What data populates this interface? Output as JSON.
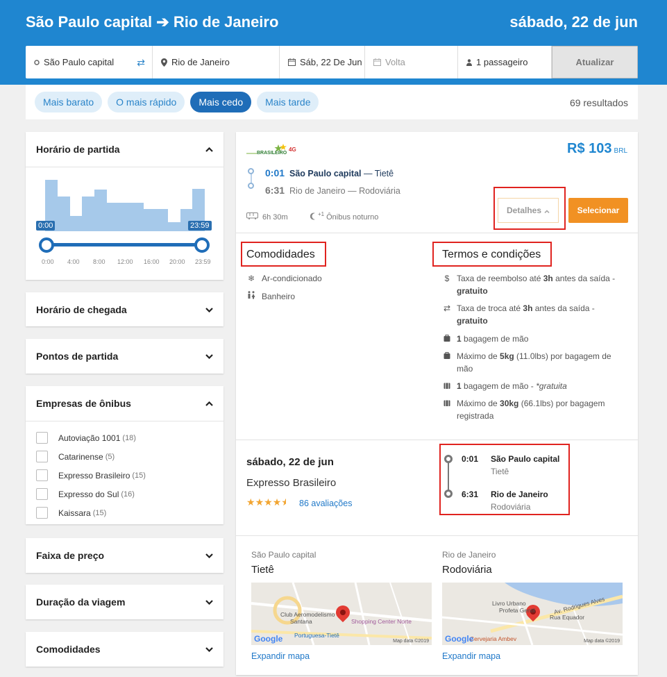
{
  "header": {
    "title": "São Paulo capital ➔ Rio de Janeiro",
    "date": "sábado, 22 de jun",
    "origin": "São Paulo capital",
    "destination": "Rio de Janeiro",
    "depart_date": "Sáb, 22 De Jun",
    "return_placeholder": "Volta",
    "passengers": "1 passageiro",
    "update_label": "Atualizar"
  },
  "sort": {
    "chips": [
      "Mais barato",
      "O mais rápido",
      "Mais cedo",
      "Mais tarde"
    ],
    "active_index": 2,
    "results": "69 resultados"
  },
  "filters": {
    "departure_time": {
      "title": "Horário de partida",
      "start_label": "0:00",
      "end_label": "23:59",
      "ticks": [
        "0:00",
        "4:00",
        "8:00",
        "12:00",
        "16:00",
        "20:00",
        "23:59"
      ],
      "histogram": [
        1.0,
        0.68,
        0.3,
        0.68,
        0.81,
        0.55,
        0.55,
        0.55,
        0.43,
        0.43,
        0.17,
        0.43,
        0.82
      ]
    },
    "arrival_time": "Horário de chegada",
    "departure_points": "Pontos de partida",
    "companies": {
      "title": "Empresas de ônibus",
      "items": [
        {
          "name": "Autoviação 1001",
          "count": "(18)"
        },
        {
          "name": "Catarinense",
          "count": "(5)"
        },
        {
          "name": "Expresso Brasileiro",
          "count": "(15)"
        },
        {
          "name": "Expresso do Sul",
          "count": "(16)"
        },
        {
          "name": "Kaissara",
          "count": "(15)"
        }
      ]
    },
    "price_range": "Faixa de preço",
    "trip_duration": "Duração da viagem",
    "amenities": "Comodidades"
  },
  "trip": {
    "logo_text": "BRASILEIRO",
    "logo_badge": "4G",
    "price": "R$ 103",
    "currency": "BRL",
    "depart_time": "0:01",
    "depart_place": "São Paulo capital",
    "depart_station": "— Tietê",
    "arrive_time": "6:31",
    "arrive_place": "Rio de Janeiro",
    "arrive_station": "— Rodoviária",
    "duration": "6h 30m",
    "night_label": "Ônibus noturno",
    "night_badge": "+1",
    "details_label": "Detalhes",
    "select_label": "Selecionar",
    "amenities_title": "Comodidades",
    "amenities": [
      "Ar-condicionado",
      "Banheiro"
    ],
    "terms_title": "Termos e condições",
    "terms": {
      "refund_pre": "Taxa de reembolso até ",
      "refund_hours": "3h",
      "refund_post": " antes da saída -",
      "refund_free": "gratuito",
      "exchange_pre": "Taxa de troca até ",
      "exchange_hours": "3h",
      "exchange_post": " antes da saída -",
      "exchange_free": "gratuito",
      "hand_bag_count": "1",
      "hand_bag_label": " bagagem de mão",
      "hand_max_pre": "Máximo de ",
      "hand_max_kg": "5kg",
      "hand_max_post": " (11.0lbs) por bagagem de mão",
      "hand_bag2_count": "1",
      "hand_bag2_label": " bagagem de mão - ",
      "hand_bag2_free": "*gratuita",
      "checked_max_pre": "Máximo de ",
      "checked_max_kg": "30kg",
      "checked_max_post": " (66.1lbs) por bagagem registrada"
    },
    "summary_date": "sábado, 22 de jun",
    "company": "Expresso Brasileiro",
    "rating_stars": 4.5,
    "reviews": "86 avaliações",
    "timeline": {
      "depart_time": "0:01",
      "depart_city": "São Paulo capital",
      "depart_station": "Tietê",
      "arrive_time": "6:31",
      "arrive_city": "Rio de Janeiro",
      "arrive_station": "Rodoviária"
    },
    "maps": [
      {
        "city": "São Paulo capital",
        "station": "Tietê",
        "expand": "Expandir mapa",
        "labels": [
          "Club Aeromodelismo",
          "Santana",
          "Shopping Center Norte",
          "Portuguesa-Tietê"
        ],
        "google": "Google",
        "mapdata": "Map data ©2019"
      },
      {
        "city": "Rio de Janeiro",
        "station": "Rodoviária",
        "expand": "Expandir mapa",
        "labels": [
          "Livro Urbano",
          "Profeta Gentil",
          "Av. Rodrigues Alves",
          "Rua Equador",
          "Cervejaria Ambev"
        ],
        "google": "Google",
        "mapdata": "Map data ©2019"
      }
    ]
  },
  "colors": {
    "brand_blue": "#1f86d0",
    "active_chip": "#1f6db8",
    "select_orange": "#f19123",
    "highlight_red": "#e0231f"
  }
}
